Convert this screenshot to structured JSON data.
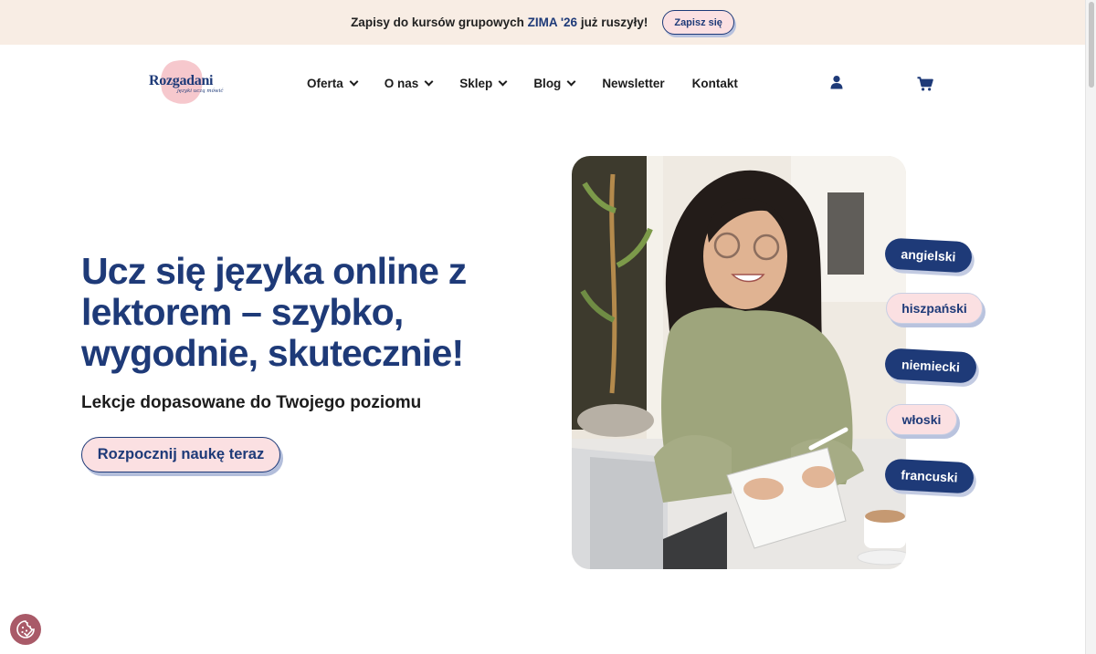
{
  "topbar": {
    "text_before": "Zapisy do kursów grupowych ",
    "text_accent": "ZIMA '26",
    "text_after": " już ruszyły!",
    "button_label": "Zapisz się"
  },
  "logo": {
    "wordmark": "Rozgadani",
    "tagline": "języki uczą mówić"
  },
  "nav": {
    "items": [
      {
        "label": "Oferta",
        "has_dropdown": true
      },
      {
        "label": "O nas",
        "has_dropdown": true
      },
      {
        "label": "Sklep",
        "has_dropdown": true
      },
      {
        "label": "Blog",
        "has_dropdown": true
      },
      {
        "label": "Newsletter",
        "has_dropdown": false
      },
      {
        "label": "Kontakt",
        "has_dropdown": false
      }
    ],
    "icons": {
      "account": "user-icon",
      "cart": "cart-icon"
    }
  },
  "hero": {
    "title": "Ucz się języka online z lektorem – szybko, wygodnie, skutecznie!",
    "subtitle": "Lekcje dopasowane do Twojego poziomu",
    "cta_label": "Rozpocznij naukę teraz"
  },
  "languages": [
    "angielski",
    "hiszpański",
    "niemiecki",
    "włoski",
    "francuski"
  ],
  "cookie": {
    "icon": "cookie-settings-icon"
  },
  "colors": {
    "brand_navy": "#1e3a78",
    "brand_pink": "#fbe0e2",
    "topbar_bg": "#f8ede4",
    "cookie_badge": "#a95a68"
  }
}
